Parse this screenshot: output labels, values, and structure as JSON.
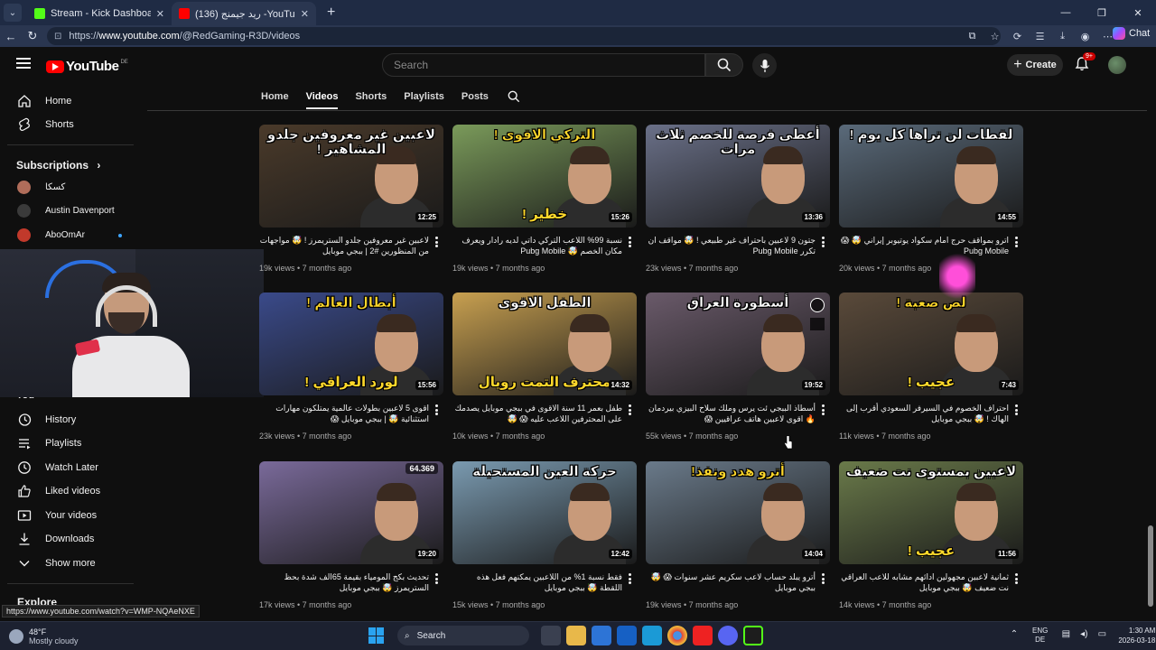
{
  "browser": {
    "tabs": [
      {
        "label": "Stream - Kick Dashboard",
        "active": false,
        "favicon_color": "#53fc18"
      },
      {
        "label": "(136) ريد جيمنج -YouTube - AMING",
        "active": true,
        "favicon_color": "#ff0000"
      }
    ],
    "url_prefix": "https://",
    "url_domain": "www.youtube.com",
    "url_path": "/@RedGaming-R3D/videos",
    "chat_label": "Chat"
  },
  "header": {
    "logo_word": "YouTube",
    "logo_region": "DE",
    "search_placeholder": "Search",
    "create_label": "Create",
    "notif_badge": "9+"
  },
  "sidebar": {
    "top_items": [
      {
        "label": "Home",
        "icon": "home-icon"
      },
      {
        "label": "Shorts",
        "icon": "shorts-icon"
      }
    ],
    "subscriptions_heading": "Subscriptions",
    "subscriptions": [
      {
        "label": "كسكا",
        "color": "#b06d5a"
      },
      {
        "label": "Austin Davenport",
        "color": "#3a3a3a"
      },
      {
        "label": "AboOmAr",
        "color": "#c1392b"
      }
    ],
    "you_heading": "You",
    "you_items": [
      {
        "label": "History",
        "icon": "history-icon"
      },
      {
        "label": "Playlists",
        "icon": "playlists-icon"
      },
      {
        "label": "Watch Later",
        "icon": "watch-later-icon"
      },
      {
        "label": "Liked videos",
        "icon": "like-icon"
      },
      {
        "label": "Your videos",
        "icon": "your-videos-icon"
      },
      {
        "label": "Downloads",
        "icon": "download-icon"
      },
      {
        "label": "Show more",
        "icon": "chevron-down-icon"
      }
    ],
    "explore_heading": "Explore"
  },
  "channel_tabs": [
    {
      "label": "Home",
      "active": false
    },
    {
      "label": "Videos",
      "active": true
    },
    {
      "label": "Shorts",
      "active": false
    },
    {
      "label": "Playlists",
      "active": false
    },
    {
      "label": "Posts",
      "active": false
    }
  ],
  "videos": [
    {
      "thumb_top": "لاعبين غير معروفين جلدو المشاهير !",
      "thumb_bottom": "",
      "duration": "12:25",
      "bg": "#4a3a2a",
      "title": "لاعبين غير معروفين جلدو الستريمرز ! 🤯 مواجهات من المنظورين #2 ‌| ببجي موبايل",
      "views": "19k views",
      "age": "7 months ago"
    },
    {
      "thumb_top": "التركي الاقوى !",
      "thumb_bottom": "خطير !",
      "duration": "15:26",
      "bg": "#7a9a5a",
      "title": "نسبة 99% اللاعب التركي داتي لديه رادار ويعرف مكان الخصم 🤯 Pubg Mobile",
      "views": "19k views",
      "age": "7 months ago"
    },
    {
      "thumb_top": "أعطى فرصة للخصم ثلاث مرات",
      "thumb_bottom": "",
      "duration": "13:36",
      "bg": "#6a7088",
      "title": "جتون 9 لاعبين باحتراف غير طبيعي ! 🤯 مواقف ان تكرر Pubg Mobile",
      "views": "23k views",
      "age": "7 months ago"
    },
    {
      "thumb_top": "لقطات لن تراها كل يوم !",
      "thumb_bottom": "",
      "duration": "14:55",
      "bg": "#5a6a7a",
      "title": "اترو بمواقف حرج امام سكواد يوتيوبر إيراني 🤯 😱 Pubg Mobile",
      "views": "20k views",
      "age": "7 months ago"
    },
    {
      "thumb_top": "أبطال العالم !",
      "thumb_bottom": "لورد العراقي !",
      "duration": "15:56",
      "bg": "#3a4a8a",
      "title": "اقوى 5 لاعبين بطولات عالمية يمتلكون مهارات استثنائية 🤯 | ببجي موبايل 😱",
      "views": "23k views",
      "age": "7 months ago"
    },
    {
      "thumb_top": "الطفل الاقوى",
      "thumb_bottom": "محترف التمت رويال",
      "duration": "14:32",
      "bg": "#c8a050",
      "title": "طفل بعمر 11 سنة الاقوى في ببجي موبايل يصدمك على المحترفين اللاعب عليه 😱 🤯",
      "views": "10k views",
      "age": "7 months ago"
    },
    {
      "thumb_top": "أسطورة العراق",
      "thumb_bottom": "",
      "duration": "19:52",
      "bg": "#6a5a6a",
      "title": "أسطاذ الببجي ئت يرس وملك سلاح البيزي بيردمان 🔥 اقوى لاعبين هاتف عراقيين 😱",
      "views": "55k views",
      "age": "7 months ago"
    },
    {
      "thumb_top": "لص صعبة !",
      "thumb_bottom": "عجيب !",
      "duration": "7:43",
      "bg": "#5a4a3a",
      "title": "احتراف الخصوم في السيرفر السعودي أقرب إلى الهاك ! 🤯 ببجي موبايل",
      "views": "11k views",
      "age": "7 months ago"
    },
    {
      "thumb_top": "",
      "thumb_bottom": "",
      "duration": "19:20",
      "bg": "#7a6a9a",
      "badge": "64.369",
      "title": "تحديث بكج المومياء بقيمة 65الف شدة بحظ الستريمرز 🤯 ببجي موبايل",
      "views": "17k views",
      "age": "7 months ago"
    },
    {
      "thumb_top": "حركة العين المستحيلة",
      "thumb_bottom": "",
      "duration": "12:42",
      "bg": "#7a9ab0",
      "title": "فقط نسبة 1% من اللاعبين يمكنهم فعل هذه اللقطة 🤯 ببجي موبايل",
      "views": "15k views",
      "age": "7 months ago"
    },
    {
      "thumb_top": "أترو هدد ونفذ!",
      "thumb_bottom": "",
      "duration": "14:04",
      "bg": "#6a7a8a",
      "title": "أترو يبلد حساب لاعب سكريم عشر سنوات 😱 🤯 ببجي موبايل",
      "views": "19k views",
      "age": "7 months ago"
    },
    {
      "thumb_top": "لاعبين بمستوى نت ضعيف",
      "thumb_bottom": "عجيب !",
      "duration": "11:56",
      "bg": "#6a7a4a",
      "title": "ثمانية لاعبين مجهولين ادائهم مشابه للاعب العراقي نت ضعيف 🤯 ببجي موبايل",
      "views": "14k views",
      "age": "7 months ago"
    }
  ],
  "status_link": "https://www.youtube.com/watch?v=WMP-NQAeNXE",
  "taskbar": {
    "temp": "48°F",
    "weather": "Mostly cloudy",
    "search_label": "Search",
    "lang_1": "ENG",
    "lang_2": "DE",
    "time": "1:30 AM",
    "date": "2026-03-18"
  }
}
